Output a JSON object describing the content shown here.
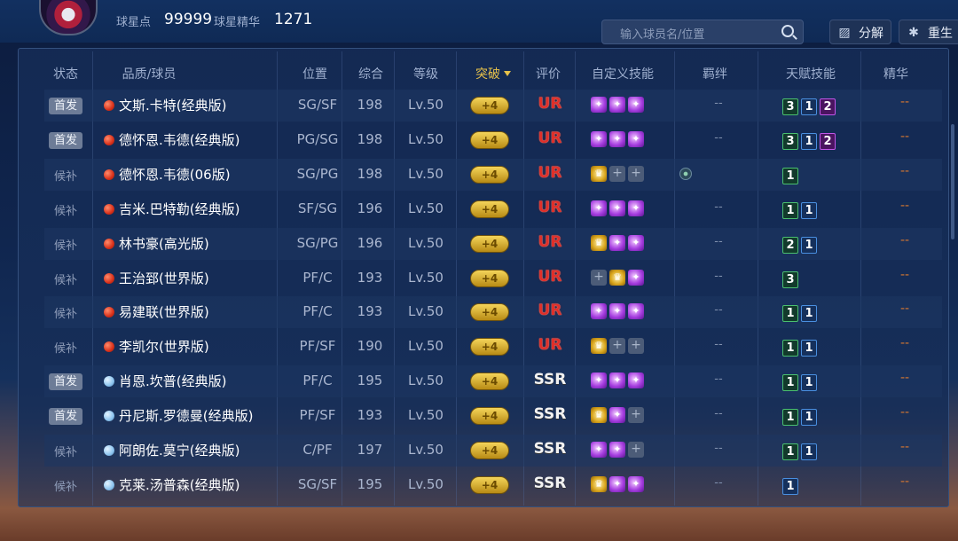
{
  "header": {
    "star_points_label": "球星点",
    "star_points_value": "99999",
    "essence_label": "球星精华",
    "essence_value": "1271",
    "search_placeholder": "输入球员名/位置",
    "decompose_label": "分解",
    "rebirth_label": "重生"
  },
  "columns": [
    "状态",
    "品质/球员",
    "位置",
    "综合",
    "等级",
    "突破",
    "评价",
    "自定义技能",
    "羁绊",
    "天赋技能",
    "精华"
  ],
  "colors": {
    "ur": "#e0302a",
    "start_badge": "#6d7c97",
    "essence_dash": "#d87830"
  },
  "rows": [
    {
      "status": "首发",
      "quality": "red",
      "name": "文斯.卡特(经典版)",
      "pos": "SG/SF",
      "ovr": "198",
      "lvl": "Lv.50",
      "brk": "+4",
      "rate": "UR",
      "skills": [
        "purple",
        "purple",
        "purple"
      ],
      "bond": "--",
      "talents": [
        [
          "3",
          "g"
        ],
        [
          "1",
          "b"
        ],
        [
          "2",
          "p"
        ]
      ],
      "ess": "--"
    },
    {
      "status": "首发",
      "quality": "red",
      "name": "德怀恩.韦德(经典版)",
      "pos": "PG/SG",
      "ovr": "198",
      "lvl": "Lv.50",
      "brk": "+4",
      "rate": "UR",
      "skills": [
        "purple",
        "purple",
        "purple"
      ],
      "bond": "--",
      "talents": [
        [
          "3",
          "g"
        ],
        [
          "1",
          "b"
        ],
        [
          "2",
          "p"
        ]
      ],
      "ess": "--"
    },
    {
      "status": "候补",
      "quality": "red",
      "name": "德怀恩.韦德(06版)",
      "pos": "SG/PG",
      "ovr": "198",
      "lvl": "Lv.50",
      "brk": "+4",
      "rate": "UR",
      "skills": [
        "gold",
        "empty",
        "empty"
      ],
      "bond": "icon",
      "talents": [
        [
          "1",
          "g"
        ]
      ],
      "ess": "--"
    },
    {
      "status": "候补",
      "quality": "red",
      "name": "吉米.巴特勒(经典版)",
      "pos": "SF/SG",
      "ovr": "196",
      "lvl": "Lv.50",
      "brk": "+4",
      "rate": "UR",
      "skills": [
        "purple",
        "purple",
        "purple"
      ],
      "bond": "--",
      "talents": [
        [
          "1",
          "g"
        ],
        [
          "1",
          "b"
        ]
      ],
      "ess": "--"
    },
    {
      "status": "候补",
      "quality": "red",
      "name": "林书豪(高光版)",
      "pos": "SG/PG",
      "ovr": "196",
      "lvl": "Lv.50",
      "brk": "+4",
      "rate": "UR",
      "skills": [
        "gold",
        "purple",
        "purple"
      ],
      "bond": "--",
      "talents": [
        [
          "2",
          "g"
        ],
        [
          "1",
          "b"
        ]
      ],
      "ess": "--"
    },
    {
      "status": "候补",
      "quality": "red",
      "name": "王治郅(世界版)",
      "pos": "PF/C",
      "ovr": "193",
      "lvl": "Lv.50",
      "brk": "+4",
      "rate": "UR",
      "skills": [
        "empty",
        "gold",
        "purple"
      ],
      "bond": "--",
      "talents": [
        [
          "3",
          "g"
        ]
      ],
      "ess": "--"
    },
    {
      "status": "候补",
      "quality": "red",
      "name": "易建联(世界版)",
      "pos": "PF/C",
      "ovr": "193",
      "lvl": "Lv.50",
      "brk": "+4",
      "rate": "UR",
      "skills": [
        "purple",
        "purple",
        "purple"
      ],
      "bond": "--",
      "talents": [
        [
          "1",
          "g"
        ],
        [
          "1",
          "b"
        ]
      ],
      "ess": "--"
    },
    {
      "status": "候补",
      "quality": "red",
      "name": "李凯尔(世界版)",
      "pos": "PF/SF",
      "ovr": "190",
      "lvl": "Lv.50",
      "brk": "+4",
      "rate": "UR",
      "skills": [
        "gold",
        "empty",
        "empty"
      ],
      "bond": "--",
      "talents": [
        [
          "1",
          "g"
        ],
        [
          "1",
          "b"
        ]
      ],
      "ess": "--"
    },
    {
      "status": "首发",
      "quality": "blue",
      "name": "肖恩.坎普(经典版)",
      "pos": "PF/C",
      "ovr": "195",
      "lvl": "Lv.50",
      "brk": "+4",
      "rate": "SSR",
      "skills": [
        "purple",
        "purple",
        "purple"
      ],
      "bond": "--",
      "talents": [
        [
          "1",
          "g"
        ],
        [
          "1",
          "b"
        ]
      ],
      "ess": "--"
    },
    {
      "status": "首发",
      "quality": "blue",
      "name": "丹尼斯.罗德曼(经典版)",
      "pos": "PF/SF",
      "ovr": "193",
      "lvl": "Lv.50",
      "brk": "+4",
      "rate": "SSR",
      "skills": [
        "gold",
        "purple",
        "empty"
      ],
      "bond": "--",
      "talents": [
        [
          "1",
          "g"
        ],
        [
          "1",
          "b"
        ]
      ],
      "ess": "--"
    },
    {
      "status": "候补",
      "quality": "blue",
      "name": "阿朗佐.莫宁(经典版)",
      "pos": "C/PF",
      "ovr": "197",
      "lvl": "Lv.50",
      "brk": "+4",
      "rate": "SSR",
      "skills": [
        "purple",
        "purple",
        "empty"
      ],
      "bond": "--",
      "talents": [
        [
          "1",
          "g"
        ],
        [
          "1",
          "b"
        ]
      ],
      "ess": "--"
    },
    {
      "status": "候补",
      "quality": "blue",
      "name": "克莱.汤普森(经典版)",
      "pos": "SG/SF",
      "ovr": "195",
      "lvl": "Lv.50",
      "brk": "+4",
      "rate": "SSR",
      "skills": [
        "gold",
        "purple",
        "purple"
      ],
      "bond": "--",
      "talents": [
        [
          "1",
          "b"
        ]
      ],
      "ess": "--"
    }
  ]
}
